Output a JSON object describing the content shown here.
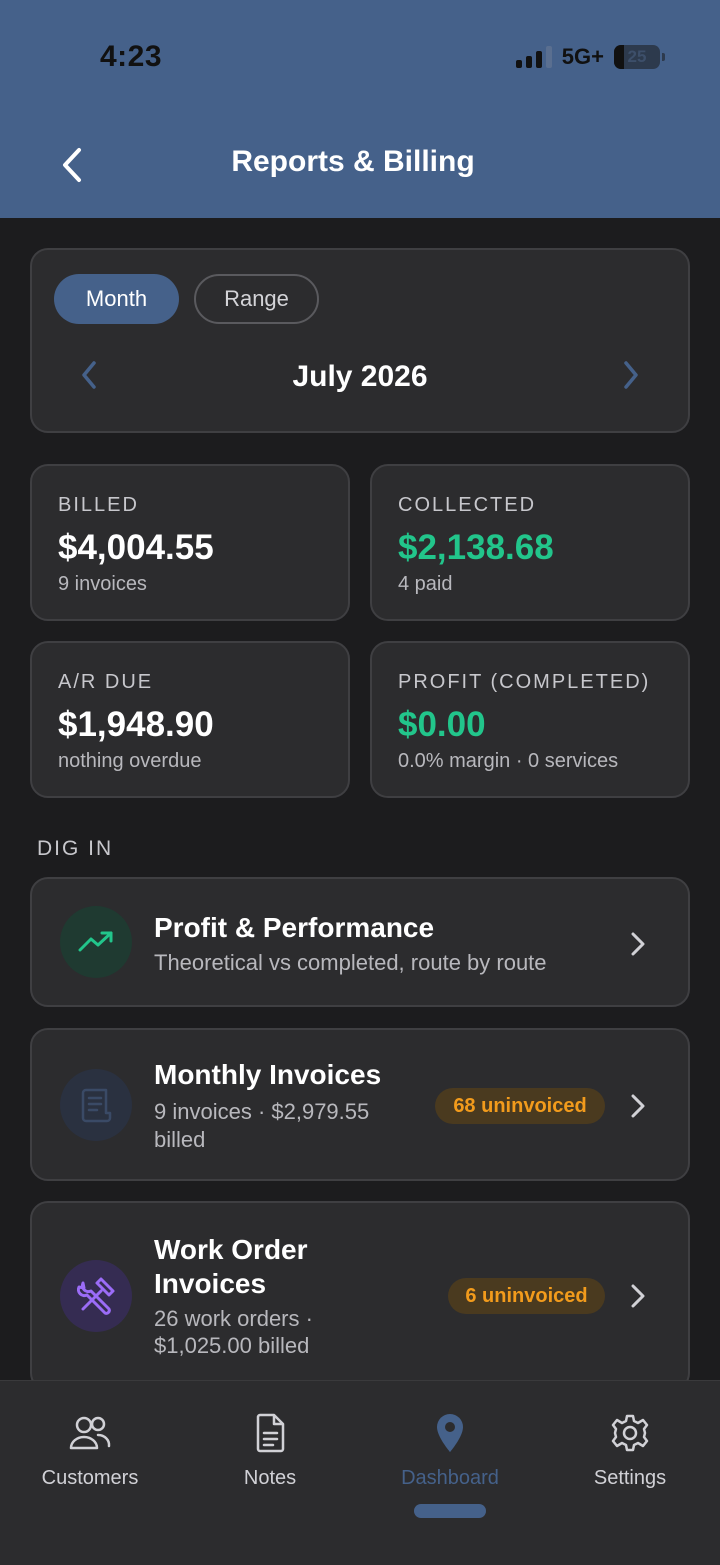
{
  "status": {
    "time": "4:23",
    "network": "5G+",
    "battery": "25"
  },
  "header": {
    "title": "Reports & Billing"
  },
  "period": {
    "toggles": [
      "Month",
      "Range"
    ],
    "active_toggle": "Month",
    "label": "July 2026"
  },
  "stats": [
    {
      "label": "BILLED",
      "value": "$4,004.55",
      "sub": "9 invoices",
      "color": "#ffffff"
    },
    {
      "label": "COLLECTED",
      "value": "$2,138.68",
      "sub": "4 paid",
      "color": "#22c58b"
    },
    {
      "label": "A/R DUE",
      "value": "$1,948.90",
      "sub": "nothing overdue",
      "color": "#ffffff"
    },
    {
      "label": "PROFIT (COMPLETED)",
      "value": "$0.00",
      "sub": "0.0% margin · 0 services",
      "color": "#22c58b"
    }
  ],
  "dig_in": {
    "section_label": "DIG IN",
    "items": [
      {
        "title": "Profit & Performance",
        "subtitle": "Theoretical vs completed, route by route",
        "icon": "trending-up-icon"
      },
      {
        "title": "Monthly Invoices",
        "subtitle_line1": "9 invoices · $2,979.55",
        "subtitle_line2": "billed",
        "badge": "68 uninvoiced",
        "icon": "receipt-icon"
      },
      {
        "title_line1": "Work Order",
        "title_line2": "Invoices",
        "subtitle_line1": "26 work orders ·",
        "subtitle_line2": "$1,025.00 billed",
        "badge": "6 uninvoiced",
        "icon": "tools-icon"
      }
    ]
  },
  "tabs": [
    {
      "label": "Customers",
      "icon": "customers-icon"
    },
    {
      "label": "Notes",
      "icon": "notes-icon"
    },
    {
      "label": "Dashboard",
      "icon": "map-pin-icon",
      "active": true
    },
    {
      "label": "Settings",
      "icon": "gear-icon"
    }
  ],
  "colors": {
    "accent": "#45618a",
    "green": "#22c58b",
    "badge_text": "#f29b1c",
    "card_bg": "#2c2c2e",
    "background": "#1c1c1e"
  }
}
